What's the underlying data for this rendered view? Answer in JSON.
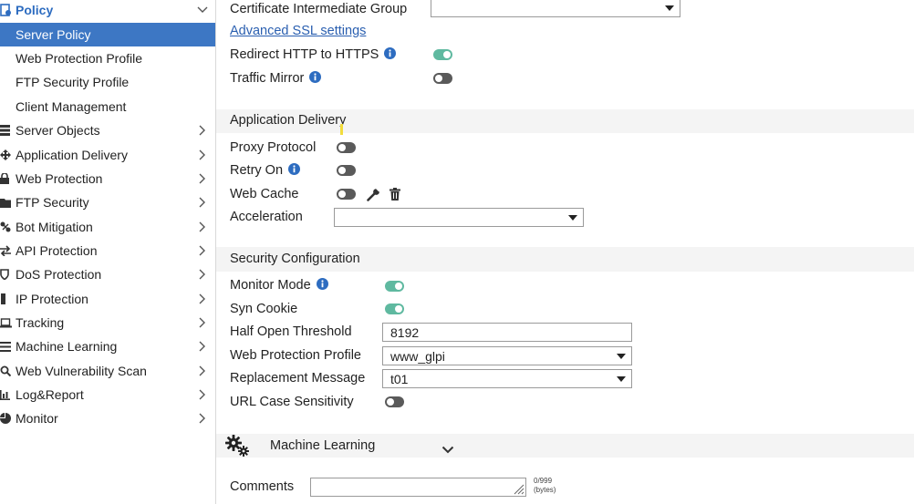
{
  "sidebar": {
    "top": {
      "label": "Policy"
    },
    "subitems": [
      {
        "label": "Server Policy"
      },
      {
        "label": "Web Protection Profile"
      },
      {
        "label": "FTP Security Profile"
      },
      {
        "label": "Client Management"
      }
    ],
    "items": [
      {
        "label": "Server Objects"
      },
      {
        "label": "Application Delivery"
      },
      {
        "label": "Web Protection"
      },
      {
        "label": "FTP Security"
      },
      {
        "label": "Bot Mitigation"
      },
      {
        "label": "API Protection"
      },
      {
        "label": "DoS Protection"
      },
      {
        "label": "IP Protection"
      },
      {
        "label": "Tracking"
      },
      {
        "label": "Machine Learning"
      },
      {
        "label": "Web Vulnerability Scan"
      },
      {
        "label": "Log&Report"
      },
      {
        "label": "Monitor"
      }
    ]
  },
  "form": {
    "cert_group": {
      "label": "Certificate Intermediate Group",
      "value": ""
    },
    "advanced_ssl": "Advanced SSL settings",
    "redirect": {
      "label": "Redirect HTTP to HTTPS",
      "on": true
    },
    "traffic_mirror": {
      "label": "Traffic Mirror",
      "on": false
    },
    "app_delivery": {
      "title": "Application Delivery",
      "proxy_protocol": {
        "label": "Proxy Protocol",
        "on": false
      },
      "retry_on": {
        "label": "Retry On",
        "on": false
      },
      "web_cache": {
        "label": "Web Cache",
        "on": false
      },
      "acceleration": {
        "label": "Acceleration",
        "value": ""
      }
    },
    "security": {
      "title": "Security Configuration",
      "monitor_mode": {
        "label": "Monitor Mode",
        "on": true
      },
      "syn_cookie": {
        "label": "Syn Cookie",
        "on": true
      },
      "half_open": {
        "label": "Half Open Threshold",
        "value": "8192"
      },
      "wpp": {
        "label": "Web Protection Profile",
        "value": "www_glpi"
      },
      "replacement": {
        "label": "Replacement Message",
        "value": "t01"
      },
      "url_case": {
        "label": "URL Case Sensitivity",
        "on": false
      }
    },
    "machine_learning": {
      "label": "Machine Learning"
    },
    "comments": {
      "label": "Comments",
      "value": "",
      "counter": "0/999",
      "unit": "(bytes)"
    }
  },
  "colors": {
    "accent": "#3d77c4",
    "toggle_on": "#5fb9a0",
    "toggle_off": "#5a5a5a",
    "link": "#2a5fb0"
  },
  "icons": [
    "policy-icon",
    "chevron-down-icon",
    "chevron-right-icon",
    "info-icon",
    "wrench-icon",
    "trash-icon",
    "gears-icon"
  ]
}
